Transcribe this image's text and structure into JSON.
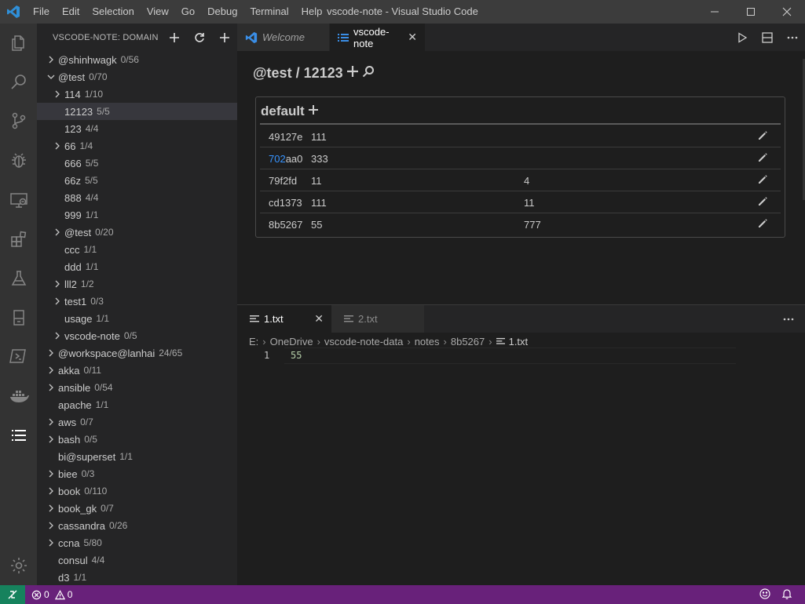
{
  "window": {
    "title": "vscode-note - Visual Studio Code"
  },
  "menu": [
    "File",
    "Edit",
    "Selection",
    "View",
    "Go",
    "Debug",
    "Terminal",
    "Help"
  ],
  "sidebar": {
    "title": "VSCODE-NOTE: DOMAIN",
    "items": [
      {
        "name": "@shinhwagk",
        "count": "0/56",
        "level": 0,
        "chevron": "right"
      },
      {
        "name": "@test",
        "count": "0/70",
        "level": 0,
        "chevron": "down"
      },
      {
        "name": "114",
        "count": "1/10",
        "level": 1,
        "chevron": "right"
      },
      {
        "name": "12123",
        "count": "5/5",
        "level": 1,
        "chevron": "none",
        "selected": true
      },
      {
        "name": "123",
        "count": "4/4",
        "level": 1,
        "chevron": "none"
      },
      {
        "name": "66",
        "count": "1/4",
        "level": 1,
        "chevron": "right"
      },
      {
        "name": "666",
        "count": "5/5",
        "level": 1,
        "chevron": "none"
      },
      {
        "name": "66z",
        "count": "5/5",
        "level": 1,
        "chevron": "none"
      },
      {
        "name": "888",
        "count": "4/4",
        "level": 1,
        "chevron": "none"
      },
      {
        "name": "999",
        "count": "1/1",
        "level": 1,
        "chevron": "none"
      },
      {
        "name": "@test",
        "count": "0/20",
        "level": 1,
        "chevron": "right"
      },
      {
        "name": "ccc",
        "count": "1/1",
        "level": 1,
        "chevron": "none"
      },
      {
        "name": "ddd",
        "count": "1/1",
        "level": 1,
        "chevron": "none"
      },
      {
        "name": "lll2",
        "count": "1/2",
        "level": 1,
        "chevron": "right"
      },
      {
        "name": "test1",
        "count": "0/3",
        "level": 1,
        "chevron": "right"
      },
      {
        "name": "usage",
        "count": "1/1",
        "level": 1,
        "chevron": "none"
      },
      {
        "name": "vscode-note",
        "count": "0/5",
        "level": 1,
        "chevron": "right"
      },
      {
        "name": "@workspace@lanhai",
        "count": "24/65",
        "level": 0,
        "chevron": "right"
      },
      {
        "name": "akka",
        "count": "0/11",
        "level": 0,
        "chevron": "right"
      },
      {
        "name": "ansible",
        "count": "0/54",
        "level": 0,
        "chevron": "right"
      },
      {
        "name": "apache",
        "count": "1/1",
        "level": 0,
        "chevron": "none"
      },
      {
        "name": "aws",
        "count": "0/7",
        "level": 0,
        "chevron": "right"
      },
      {
        "name": "bash",
        "count": "0/5",
        "level": 0,
        "chevron": "right"
      },
      {
        "name": "bi@superset",
        "count": "1/1",
        "level": 0,
        "chevron": "none"
      },
      {
        "name": "biee",
        "count": "0/3",
        "level": 0,
        "chevron": "right"
      },
      {
        "name": "book",
        "count": "0/110",
        "level": 0,
        "chevron": "right"
      },
      {
        "name": "book_gk",
        "count": "0/7",
        "level": 0,
        "chevron": "right"
      },
      {
        "name": "cassandra",
        "count": "0/26",
        "level": 0,
        "chevron": "right"
      },
      {
        "name": "ccna",
        "count": "5/80",
        "level": 0,
        "chevron": "right"
      },
      {
        "name": "consul",
        "count": "4/4",
        "level": 0,
        "chevron": "none"
      },
      {
        "name": "d3",
        "count": "1/1",
        "level": 0,
        "chevron": "none"
      }
    ]
  },
  "editor": {
    "tabs": [
      {
        "label": "Welcome",
        "active": false
      },
      {
        "label": "vscode-note",
        "active": true
      }
    ],
    "webview": {
      "path": "@test / 12123",
      "category": "default",
      "notes": [
        {
          "id": "49127e",
          "id_highlight": "",
          "id_rest": "49127e",
          "cols": [
            "111",
            ""
          ]
        },
        {
          "id": "702aa0",
          "id_highlight": "702",
          "id_rest": "aa0",
          "cols": [
            "333",
            ""
          ]
        },
        {
          "id": "79f2fd",
          "id_highlight": "",
          "id_rest": "79f2fd",
          "cols": [
            "11",
            "4"
          ]
        },
        {
          "id": "cd1373",
          "id_highlight": "",
          "id_rest": "cd1373",
          "cols": [
            "111",
            "11"
          ]
        },
        {
          "id": "8b5267",
          "id_highlight": "",
          "id_rest": "8b5267",
          "cols": [
            "55",
            "777"
          ]
        }
      ]
    }
  },
  "panel": {
    "tabs": [
      {
        "label": "1.txt",
        "active": true
      },
      {
        "label": "2.txt",
        "active": false
      }
    ],
    "breadcrumb": [
      "E:",
      "OneDrive",
      "vscode-note-data",
      "notes",
      "8b5267",
      "1.txt"
    ],
    "lines": [
      {
        "number": "1",
        "text": "55"
      }
    ]
  },
  "statusbar": {
    "errors": "0",
    "warnings": "0"
  },
  "colors": {
    "titlebar": "#3c3c3c",
    "activitybar": "#333333",
    "sidebar": "#252526",
    "editor": "#1e1e1e",
    "statusbar": "#68217a",
    "remote": "#16825d",
    "accent": "#3794ff"
  }
}
